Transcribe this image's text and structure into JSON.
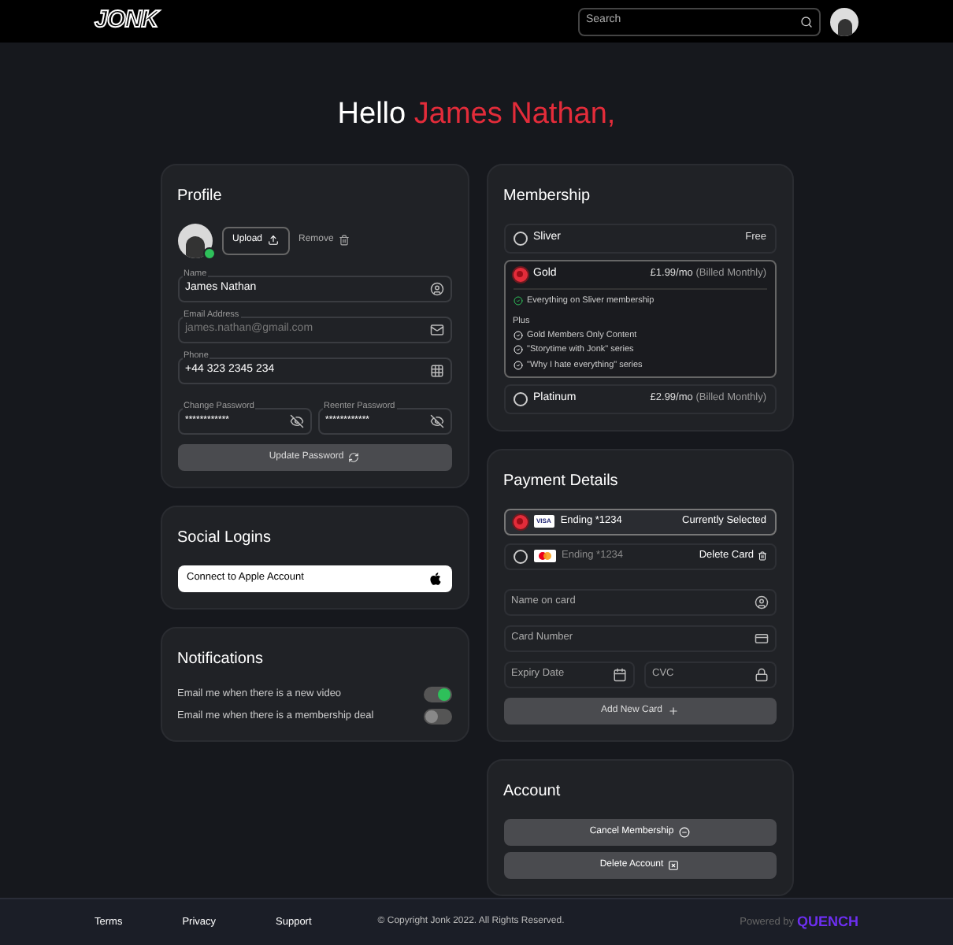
{
  "header": {
    "logo": "JONK",
    "search": {
      "placeholder": "Search"
    }
  },
  "greeting": {
    "hello": "Hello",
    "name": "James Nathan,"
  },
  "profile": {
    "title": "Profile",
    "upload": "Upload",
    "remove": "Remove",
    "fields": [
      {
        "label": "Name",
        "value": "James Nathan",
        "kind": "person",
        "disabled": false
      },
      {
        "label": "Email Address",
        "value": "james.nathan@gmail.com",
        "kind": "mail",
        "disabled": true
      },
      {
        "label": "Phone",
        "value": "+44 323 2345 234",
        "kind": "dialpad",
        "disabled": false
      }
    ],
    "passwords": [
      {
        "label": "Change Password",
        "value": "************"
      },
      {
        "label": "Reenter Password",
        "value": "************"
      }
    ],
    "update_button": "Update Password"
  },
  "social_logins": {
    "title": "Social Logins",
    "button": "Connect to Apple Account"
  },
  "notifications": {
    "title": "Notifications",
    "items": [
      {
        "label": "Email me when there is a new video",
        "on": true
      },
      {
        "label": "Email me when there is a membership deal",
        "on": false
      }
    ]
  },
  "membership": {
    "title": "Membership",
    "plans": [
      {
        "name": "Sliver",
        "price": "Free",
        "selected": false
      },
      {
        "name": "Gold",
        "price": "£1.99/mo",
        "note": "(Billed Monthly)",
        "selected": true,
        "base": "Everything on Sliver membership",
        "plus": "Plus",
        "features": [
          "Gold Members Only Content",
          "\"Storytime with Jonk\" series",
          "\"Why I hate everything\" series"
        ]
      },
      {
        "name": "Platinum",
        "price": "£2.99/mo",
        "note": "(Billed Monthly)",
        "selected": false
      }
    ]
  },
  "payment": {
    "title": "Payment Details",
    "cards": [
      {
        "kind": "visa",
        "brand_label": "VISA",
        "label": "Ending *1234",
        "action": "Currently Selected",
        "selected": true
      },
      {
        "kind": "mastercard",
        "label": "Ending *1234",
        "action": "Delete Card",
        "selected": false
      }
    ],
    "fields": [
      {
        "placeholder": "Name on card",
        "kind": "person"
      },
      {
        "placeholder": "Card Number",
        "kind": "card"
      },
      {
        "placeholder": "Expiry Date",
        "kind": "calendar"
      },
      {
        "placeholder": "CVC",
        "kind": "lock"
      }
    ],
    "add_button": "Add New Card"
  },
  "account": {
    "title": "Account",
    "buttons": [
      {
        "label": "Cancel Membership",
        "kind": "cancel"
      },
      {
        "label": "Delete Account",
        "kind": "delete"
      }
    ]
  },
  "footer": {
    "links": [
      "Terms",
      "Privacy",
      "Support"
    ],
    "copyright": "© Copyright Jonk 2022. All Rights Reserved.",
    "powered_by": "Powered by",
    "brand": "QUENCH"
  }
}
